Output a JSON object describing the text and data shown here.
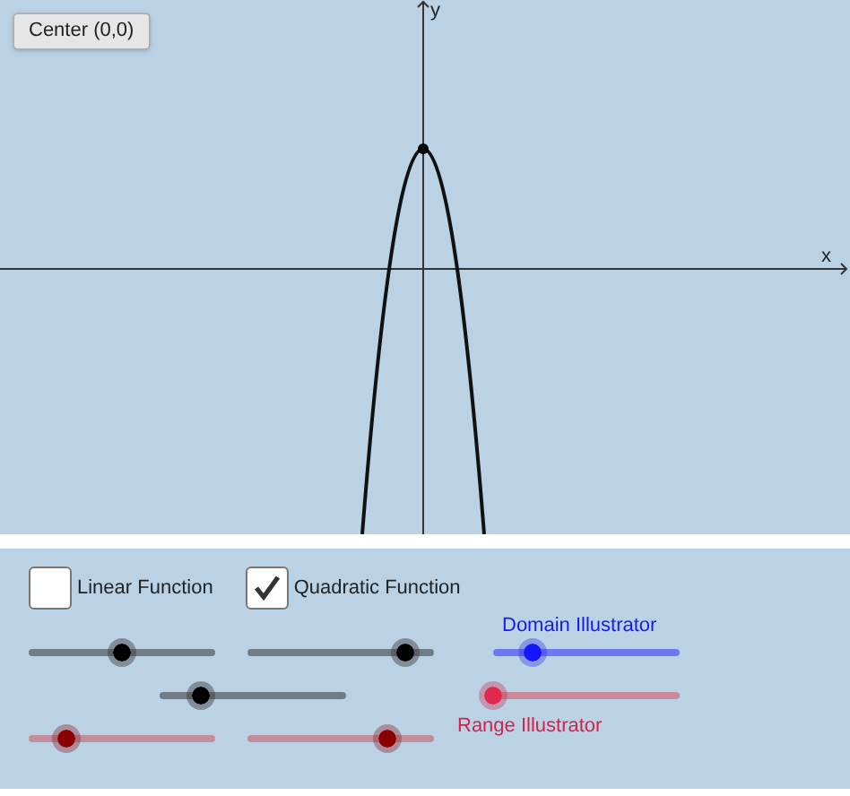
{
  "graph": {
    "button": "Center (0,0)",
    "x_axis_label": "x",
    "y_axis_label": "y"
  },
  "checkboxes": [
    {
      "label": "Linear Function",
      "checked": false
    },
    {
      "label": "Quadratic Function",
      "checked": true
    }
  ],
  "slider_rows": [
    [
      {
        "kind": "black",
        "level": 0.5
      },
      {
        "kind": "black",
        "level": 0.85
      }
    ],
    [
      {
        "kind": "black",
        "level": 0.22
      }
    ],
    [
      {
        "kind": "maroon",
        "level": 0.2
      },
      {
        "kind": "maroon",
        "level": 0.75
      }
    ]
  ],
  "domain_illustrator": {
    "label": "Domain Illustrator",
    "kind": "blue",
    "level": 0.21
  },
  "range_illustrator": {
    "label": "Range Illustrator",
    "kind": "red",
    "level": 0
  }
}
